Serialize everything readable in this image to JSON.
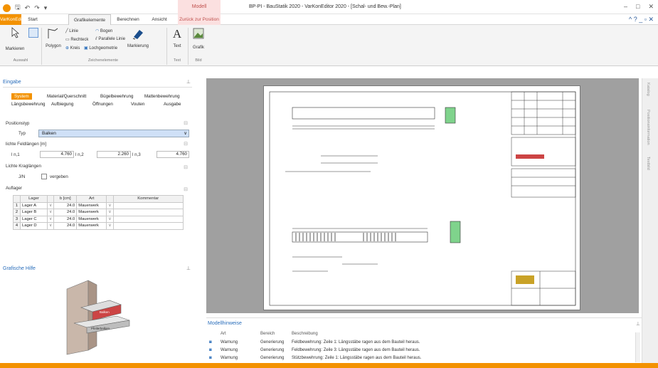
{
  "window": {
    "title": "BP-PI - BauStatik 2020 - VarKonEditor 2020 - [Schal- und Bew.-Plan]",
    "context_header": "Modell",
    "controls": [
      "–",
      "□",
      "✕"
    ],
    "help": "^ ? _ ▫ ✕"
  },
  "tabs": {
    "verkn": "VarKonEditor",
    "start": "Start",
    "grafik": "Grafikelemente",
    "berechnen": "Berechnen",
    "ansicht": "Ansicht",
    "zurueck": "Zurück zur Position"
  },
  "ribbon": {
    "markieren": "Markieren",
    "auswahl": "Auswahl",
    "polygon": "Polygon",
    "linie": "Linie",
    "bogen": "Bogen",
    "rechteck": "Rechteck",
    "parallele": "Parallele Linie",
    "kreis": "Kreis",
    "lochgeometrie": "Lochgeometrie",
    "markierung": "Markierung",
    "zeichenelemente": "Zeichenelemente",
    "text": "Text",
    "text_group": "Text",
    "grafik": "Grafik",
    "bild": "Bild"
  },
  "eingabe": {
    "title": "Eingabe",
    "pin": "⊥",
    "subtabs": {
      "system": "System",
      "material": "Material/Querschnitt",
      "buegel": "Bügelbewehrung",
      "matten": "Mattenbewehrung",
      "laengs": "Längsbewehrung",
      "aufbiegung": "Aufbiegung",
      "oeffnungen": "Öffnungen",
      "vouten": "Vouten",
      "ausgabe": "Ausgabe"
    },
    "positionstyp": "Positionstyp",
    "typ_label": "Typ",
    "typ_value": "Balken",
    "lichte_label": "lichte Feldlängen [m]",
    "ln1": "l n,1",
    "ln1_val": "4.760",
    "ln2": "l n,2",
    "ln2_val": "2.260",
    "ln3": "l n,3",
    "ln3_val": "4.760",
    "krag_label": "Lichte Kraglängen",
    "jn_label": "J/N",
    "vergeben": "vergeben",
    "auflager_label": "Auflager",
    "auflager_headers": [
      "",
      "Lager",
      "",
      "b [cm]",
      "Art",
      "",
      "Kommentar"
    ],
    "auflager_rows": [
      [
        "1",
        "Lager A",
        "∨",
        "24.0",
        "Mauerwerk",
        "∨",
        ""
      ],
      [
        "2",
        "Lager B",
        "∨",
        "24.0",
        "Mauerwerk",
        "∨",
        ""
      ],
      [
        "3",
        "Lager C",
        "∨",
        "24.0",
        "Mauerwerk",
        "∨",
        ""
      ],
      [
        "4",
        "Lager D",
        "∨",
        "24.0",
        "Mauerwerk",
        "∨",
        ""
      ]
    ]
  },
  "grafhilfe": {
    "title": "Grafische Hilfe",
    "balken": "Balken",
    "auflager": "Pfeilerbalken"
  },
  "sidestrip": [
    "Katalog",
    "Positionsinformation",
    "Textbild"
  ],
  "modhin": {
    "title": "Modellhinweise",
    "headers": [
      "Art",
      "Bereich",
      "Beschreibung"
    ],
    "rows": [
      [
        "Warnung",
        "Generierung",
        "Feldbewehrung: Zeile 1: Längsstäbe ragen aus dem Bauteil heraus."
      ],
      [
        "Warnung",
        "Generierung",
        "Feldbewehrung: Zeile 3: Längsstäbe ragen aus dem Bauteil heraus."
      ],
      [
        "Warnung",
        "Generierung",
        "Stützbewehrung: Zeile 1: Längsstäbe ragen aus dem Bauteil heraus."
      ]
    ]
  },
  "colors": {
    "accent": "#f39200",
    "context": "#c0504d",
    "select": "#cfe0f7"
  }
}
